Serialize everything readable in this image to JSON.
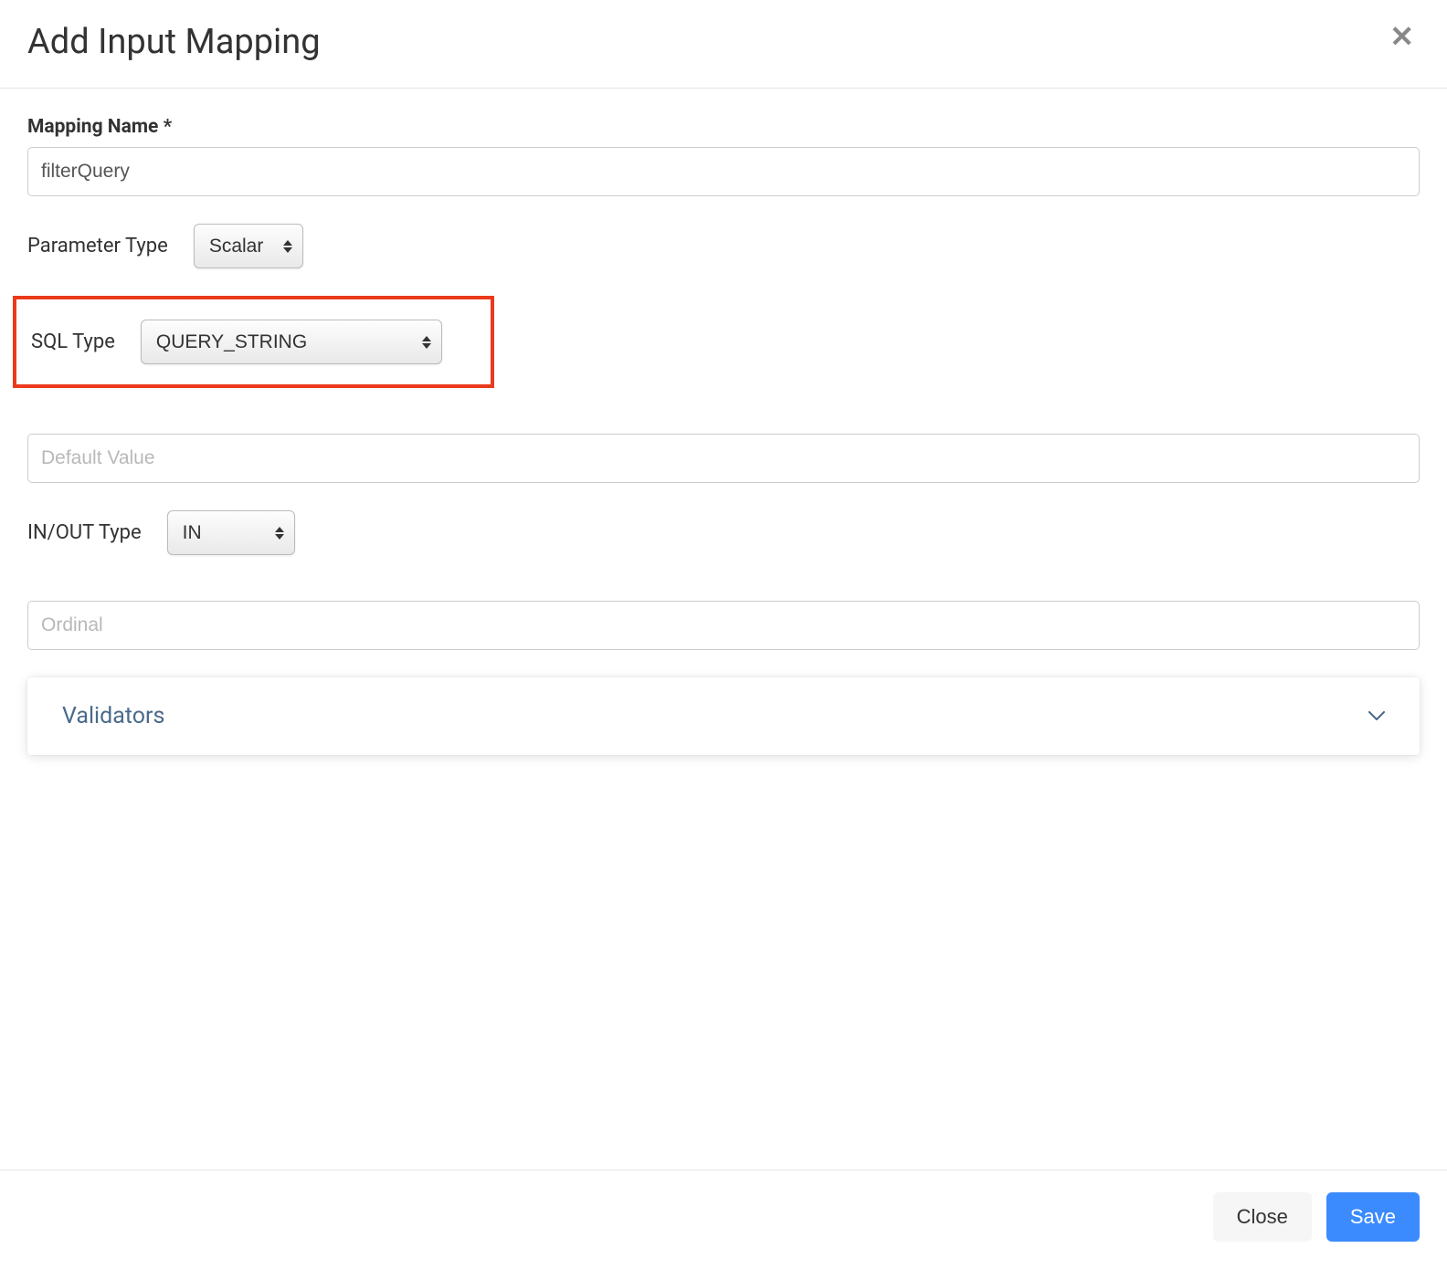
{
  "modal": {
    "title": "Add Input Mapping"
  },
  "form": {
    "mapping_name_label": "Mapping Name *",
    "mapping_name_value": "filterQuery",
    "parameter_type_label": "Parameter Type",
    "parameter_type_value": "Scalar",
    "sql_type_label": "SQL Type",
    "sql_type_value": "QUERY_STRING",
    "default_value_placeholder": "Default Value",
    "default_value_value": "",
    "inout_type_label": "IN/OUT Type",
    "inout_type_value": "IN",
    "ordinal_placeholder": "Ordinal",
    "ordinal_value": ""
  },
  "validators": {
    "title": "Validators"
  },
  "footer": {
    "close_label": "Close",
    "save_label": "Save"
  }
}
